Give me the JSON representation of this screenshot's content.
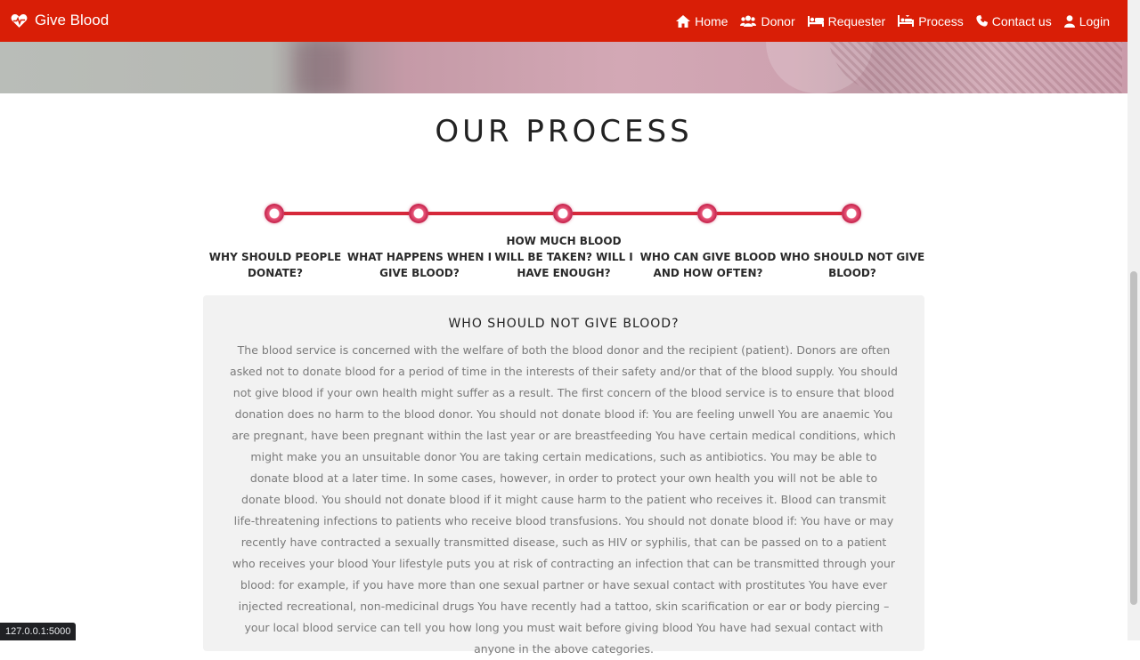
{
  "brand": {
    "name": "Give Blood",
    "icon": "heartbeat-icon"
  },
  "nav": [
    {
      "label": "Home",
      "icon": "home-icon"
    },
    {
      "label": "Donor",
      "icon": "users-icon"
    },
    {
      "label": "Requester",
      "icon": "bed-icon"
    },
    {
      "label": "Process",
      "icon": "hospital-bed-icon"
    },
    {
      "label": "Contact us",
      "icon": "phone-icon"
    },
    {
      "label": "Login",
      "icon": "user-icon"
    }
  ],
  "section_title": "OUR PROCESS",
  "steps": [
    {
      "label": "WHY SHOULD PEOPLE DONATE?"
    },
    {
      "label": "WHAT HAPPENS WHEN I GIVE BLOOD?"
    },
    {
      "label": "HOW MUCH BLOOD WILL BE TAKEN? WILL I HAVE ENOUGH?"
    },
    {
      "label": "WHO CAN GIVE BLOOD AND HOW OFTEN?"
    },
    {
      "label": "WHO SHOULD NOT GIVE BLOOD?"
    }
  ],
  "active_step": {
    "title": "WHO SHOULD NOT GIVE BLOOD?",
    "body": "The blood service is concerned with the welfare of both the blood donor and the recipient (patient). Donors are often asked not to donate blood for a period of time in the interests of their safety and/or that of the blood supply. You should not give blood if your own health might suffer as a result. The first concern of the blood service is to ensure that blood donation does no harm to the blood donor. You should not donate blood if: You are feeling unwell You are anaemic You are pregnant, have been pregnant within the last year or are breastfeeding You have certain medical conditions, which might make you an unsuitable donor You are taking certain medications, such as antibiotics. You may be able to donate blood at a later time. In some cases, however, in order to protect your own health you will not be able to donate blood. You should not donate blood if it might cause harm to the patient who receives it. Blood can transmit life-threatening infections to patients who receive blood transfusions. You should not donate blood if: You have or may recently have contracted a sexually transmitted disease, such as HIV or syphilis, that can be passed on to a patient who receives your blood Your lifestyle puts you at risk of contracting an infection that can be transmitted through your blood: for example, if you have more than one sexual partner or have sexual contact with prostitutes You have ever injected recreational, non-medicinal drugs You have recently had a tattoo, skin scarification or ear or body piercing – your local blood service can tell you how long you must wait before giving blood You have had sexual contact with anyone in the above categories."
  },
  "status_url": "127.0.0.1:5000",
  "colors": {
    "navbar": "#d91e06",
    "timeline": "#d6283a",
    "box": "#f2f2f2"
  }
}
